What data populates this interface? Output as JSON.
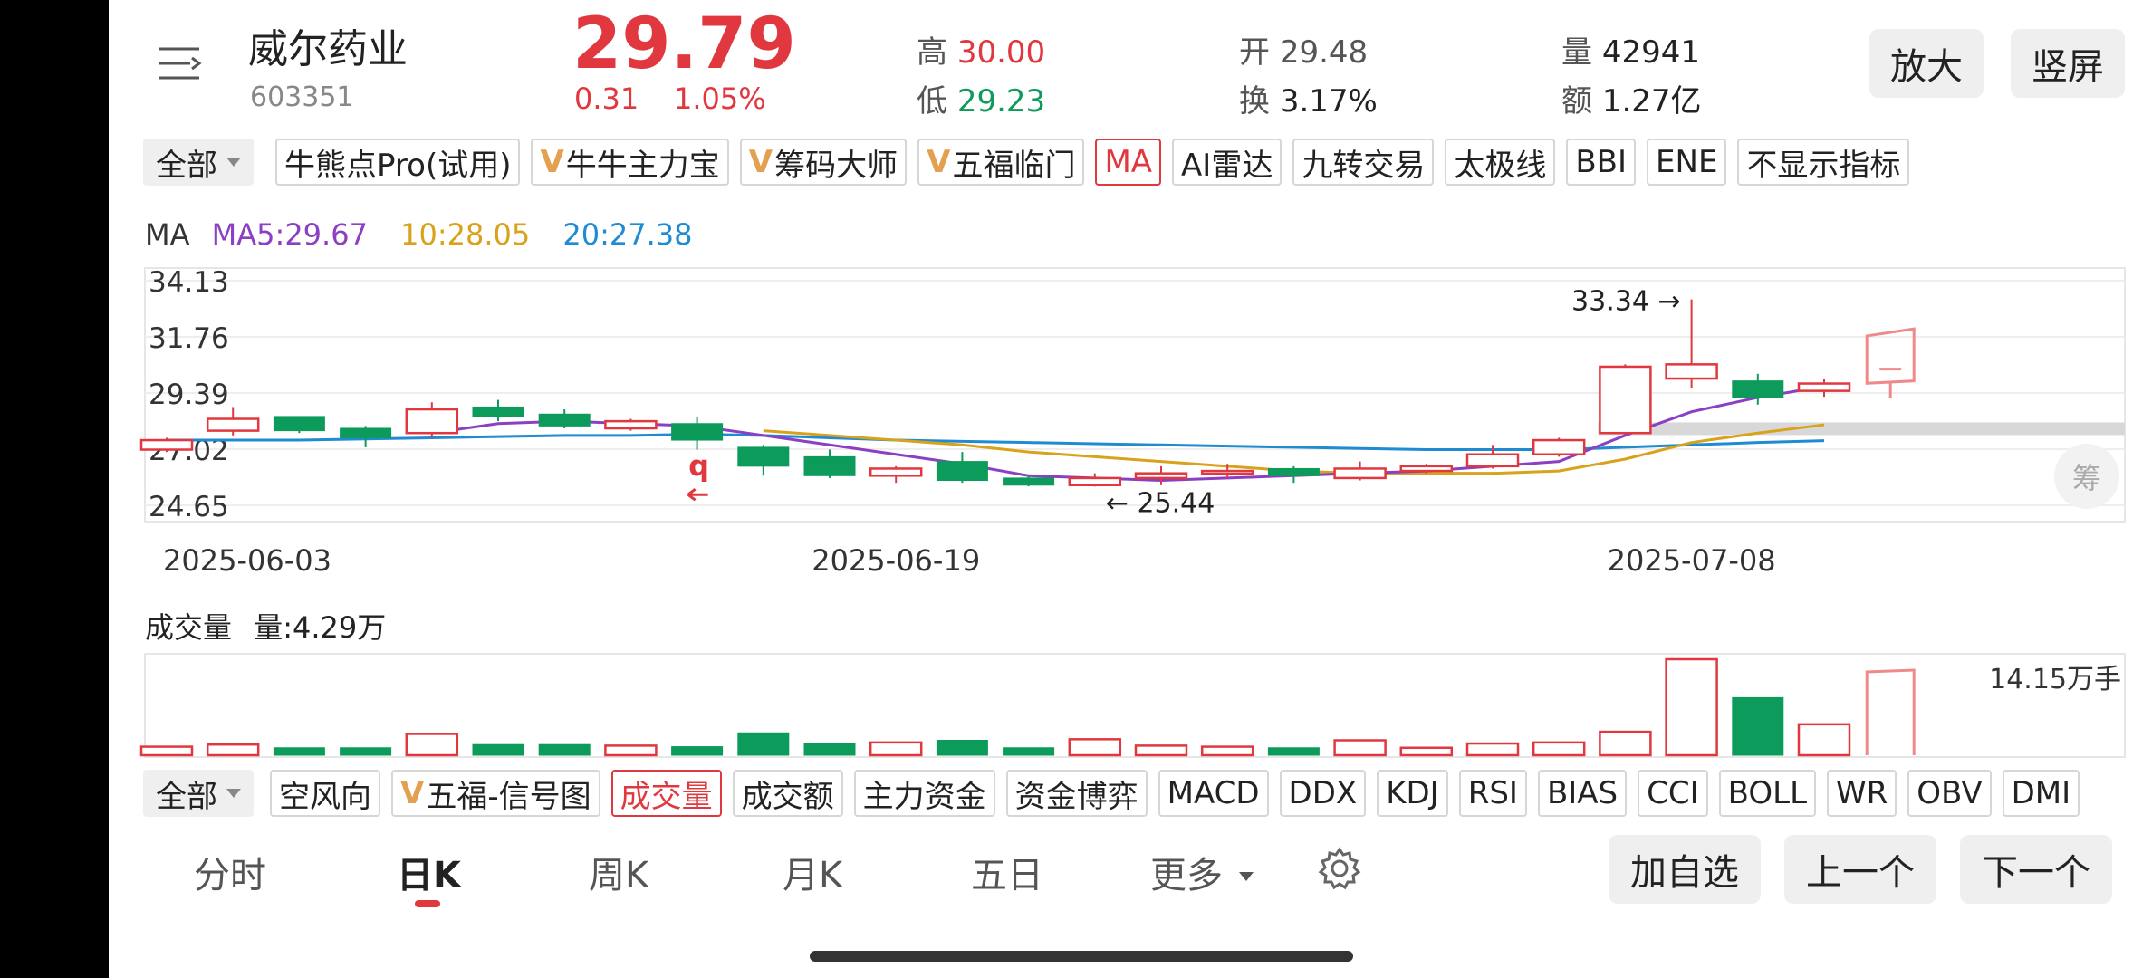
{
  "header": {
    "stock_name": "威尔药业",
    "stock_code": "603351",
    "price": "29.79",
    "change": "0.31",
    "change_pct": "1.05%",
    "high_label": "高",
    "high_value": "30.00",
    "low_label": "低",
    "low_value": "29.23",
    "open_label": "开",
    "open_value": "29.48",
    "turnover_label": "换",
    "turnover_value": "3.17%",
    "volume_label": "量",
    "volume_value": "42941",
    "amount_label": "额",
    "amount_value": "1.27亿",
    "zoom_button": "放大",
    "portrait_button": "竖屏"
  },
  "indicator_tabs": {
    "all_label": "全部",
    "items": [
      "牛熊点Pro(试用)",
      "牛牛主力宝",
      "筹码大师",
      "五福临门",
      "MA",
      "AI雷达",
      "九转交易",
      "太极线",
      "BBI",
      "ENE",
      "不显示指标"
    ],
    "selected": "MA"
  },
  "ma_legend": {
    "title": "MA",
    "ma5": "MA5:29.67",
    "ma10": "10:28.05",
    "ma20": "20:27.38"
  },
  "price_chart": {
    "y_labels": [
      "34.13",
      "31.76",
      "29.39",
      "27.02",
      "24.65"
    ],
    "x_labels": [
      "2025-06-03",
      "2025-06-19",
      "2025-07-08"
    ],
    "high_marker": "33.34",
    "low_marker": "25.44",
    "q_marker": "q",
    "chip_button": "筹"
  },
  "volume_section": {
    "title": "成交量",
    "volume_text": "量:4.29万",
    "max_label": "14.15万手"
  },
  "sub_indicator_tabs": {
    "all_label": "全部",
    "items": [
      "空风向",
      "五福-信号图",
      "成交量",
      "成交额",
      "主力资金",
      "资金博弈",
      "MACD",
      "DDX",
      "KDJ",
      "RSI",
      "BIAS",
      "CCI",
      "BOLL",
      "WR",
      "OBV",
      "DMI"
    ],
    "selected": "成交量"
  },
  "period_tabs": {
    "items": [
      "分时",
      "日K",
      "周K",
      "月K",
      "五日",
      "更多"
    ],
    "active": "日K"
  },
  "actions": {
    "add_watch": "加自选",
    "prev": "上一个",
    "next": "下一个"
  },
  "colors": {
    "up": "#e0383e",
    "down": "#0c9b5a",
    "ma5": "#8b3fc2",
    "ma10": "#d9a21c",
    "ma20": "#1e8bd2"
  },
  "chart_data": {
    "type": "candlestick",
    "title": "",
    "dates_shown": [
      "2025-06-03",
      "2025-06-19",
      "2025-07-08"
    ],
    "candles": [
      {
        "o": 27.0,
        "c": 27.4,
        "h": 27.5,
        "l": 26.9,
        "up": true
      },
      {
        "o": 27.8,
        "c": 28.3,
        "h": 28.8,
        "l": 27.6,
        "up": true
      },
      {
        "o": 28.4,
        "c": 27.8,
        "h": 28.4,
        "l": 27.7,
        "up": false
      },
      {
        "o": 27.9,
        "c": 27.5,
        "h": 28.0,
        "l": 27.1,
        "up": false
      },
      {
        "o": 27.7,
        "c": 28.7,
        "h": 29.0,
        "l": 27.5,
        "up": true
      },
      {
        "o": 28.8,
        "c": 28.4,
        "h": 29.1,
        "l": 28.2,
        "up": false
      },
      {
        "o": 28.5,
        "c": 28.0,
        "h": 28.7,
        "l": 27.9,
        "up": false
      },
      {
        "o": 27.9,
        "c": 28.2,
        "h": 28.3,
        "l": 27.8,
        "up": true
      },
      {
        "o": 28.1,
        "c": 27.4,
        "h": 28.4,
        "l": 27.0,
        "up": false
      },
      {
        "o": 27.1,
        "c": 26.3,
        "h": 27.2,
        "l": 25.9,
        "up": false
      },
      {
        "o": 26.7,
        "c": 25.9,
        "h": 27.0,
        "l": 25.8,
        "up": false
      },
      {
        "o": 25.9,
        "c": 26.2,
        "h": 26.3,
        "l": 25.6,
        "up": true
      },
      {
        "o": 26.5,
        "c": 25.7,
        "h": 26.9,
        "l": 25.6,
        "up": false
      },
      {
        "o": 25.8,
        "c": 25.5,
        "h": 25.9,
        "l": 25.45,
        "up": false
      },
      {
        "o": 25.5,
        "c": 25.8,
        "h": 26.0,
        "l": 25.44,
        "up": true
      },
      {
        "o": 25.8,
        "c": 26.0,
        "h": 26.3,
        "l": 25.5,
        "up": true
      },
      {
        "o": 26.0,
        "c": 26.1,
        "h": 26.4,
        "l": 25.8,
        "up": true
      },
      {
        "o": 26.2,
        "c": 25.9,
        "h": 26.3,
        "l": 25.6,
        "up": false
      },
      {
        "o": 25.8,
        "c": 26.2,
        "h": 26.5,
        "l": 25.7,
        "up": true
      },
      {
        "o": 26.1,
        "c": 26.3,
        "h": 26.4,
        "l": 26.0,
        "up": true
      },
      {
        "o": 26.3,
        "c": 26.8,
        "h": 27.2,
        "l": 26.2,
        "up": true
      },
      {
        "o": 26.8,
        "c": 27.4,
        "h": 27.5,
        "l": 26.7,
        "up": true
      },
      {
        "o": 27.7,
        "c": 30.5,
        "h": 30.6,
        "l": 27.7,
        "up": true
      },
      {
        "o": 30.0,
        "c": 30.6,
        "h": 33.34,
        "l": 29.6,
        "up": true
      },
      {
        "o": 29.9,
        "c": 29.2,
        "h": 30.2,
        "l": 28.9,
        "up": false
      },
      {
        "o": 29.48,
        "c": 29.79,
        "h": 30.0,
        "l": 29.23,
        "up": true
      }
    ],
    "volumes": [
      8,
      10,
      7,
      7,
      20,
      10,
      10,
      9,
      8,
      21,
      11,
      12,
      14,
      7,
      15,
      9,
      8,
      7,
      14,
      7,
      11,
      12,
      22,
      90,
      54,
      29
    ],
    "ma5": [
      null,
      null,
      null,
      null,
      27.7,
      28.1,
      28.2,
      28.1,
      28.0,
      27.6,
      27.2,
      26.8,
      26.4,
      25.9,
      25.8,
      25.7,
      25.8,
      25.9,
      26.0,
      26.1,
      26.3,
      26.5,
      27.6,
      28.6,
      29.2,
      29.67
    ],
    "ma10": [
      null,
      null,
      null,
      null,
      null,
      null,
      null,
      null,
      null,
      27.8,
      27.6,
      27.4,
      27.2,
      26.9,
      26.7,
      26.5,
      26.3,
      26.1,
      26.0,
      26.0,
      26.0,
      26.1,
      26.6,
      27.3,
      27.7,
      28.05
    ],
    "ma20": [
      27.4,
      27.4,
      27.4,
      27.45,
      27.5,
      27.55,
      27.6,
      27.6,
      27.65,
      27.6,
      27.5,
      27.4,
      27.35,
      27.3,
      27.25,
      27.2,
      27.15,
      27.1,
      27.05,
      27.0,
      27.0,
      27.0,
      27.1,
      27.2,
      27.3,
      27.38
    ],
    "ylim": [
      24.65,
      34.13
    ],
    "volume_max": "14.15万手"
  }
}
